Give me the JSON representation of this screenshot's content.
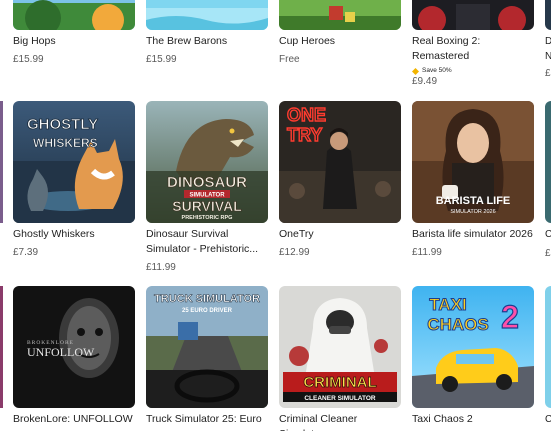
{
  "colors": {
    "text": "#1f1f1f",
    "price": "#5a5a5a",
    "save_icon": "#f2b400"
  },
  "row1": [
    {
      "title": "Big Hops",
      "price": "£15.99"
    },
    {
      "title": "The Brew Barons",
      "price": "£15.99"
    },
    {
      "title": "Cup Heroes",
      "price": "Free"
    },
    {
      "title": "Real Boxing 2: Remastered",
      "badge": "Save 50%",
      "price": "£9.49"
    }
  ],
  "row2": [
    {
      "title": "Ghostly Whiskers",
      "price": "£7.39",
      "art_text_1": "GHOSTLY",
      "art_text_2": "WHISKERS"
    },
    {
      "title": "Dinosaur Survival Simulator - Prehistoric...",
      "price": "£11.99",
      "art_text_1": "DINOSAUR",
      "art_text_2": "SIMULATOR",
      "art_text_3": "SURVIVAL",
      "art_text_4": "PREHISTORIC RPG"
    },
    {
      "title": "OneTry",
      "price": "£12.99",
      "art_text_1": "ONE",
      "art_text_2": "TRY"
    },
    {
      "title": "Barista life simulator 2026",
      "price": "£11.99",
      "art_text_1": "BARISTA LIFE",
      "art_text_2": "SIMULATOR 2026"
    }
  ],
  "row3": [
    {
      "title": "BrokenLore: UNFOLLOW",
      "art_text_1": "BROKENLORE",
      "art_text_2": "UNFOLLOW"
    },
    {
      "title": "Truck Simulator 25: Euro",
      "art_text_1": "TRUCK SIMULATOR",
      "art_text_2": "25 EURO DRIVER"
    },
    {
      "title": "Criminal Cleaner Simulator",
      "art_text_1": "CRIMINAL",
      "art_text_2": "CLEANER SIMULATOR"
    },
    {
      "title": "Taxi Chaos 2",
      "art_text_1": "TAXI",
      "art_text_2": "CHAOS",
      "art_text_3": "2"
    }
  ],
  "edge": {
    "row1_title_1": "D",
    "row1_title_2": "N",
    "row1_price": "£",
    "row2_title": "C",
    "row2_price": "£",
    "row3_title": "C"
  }
}
